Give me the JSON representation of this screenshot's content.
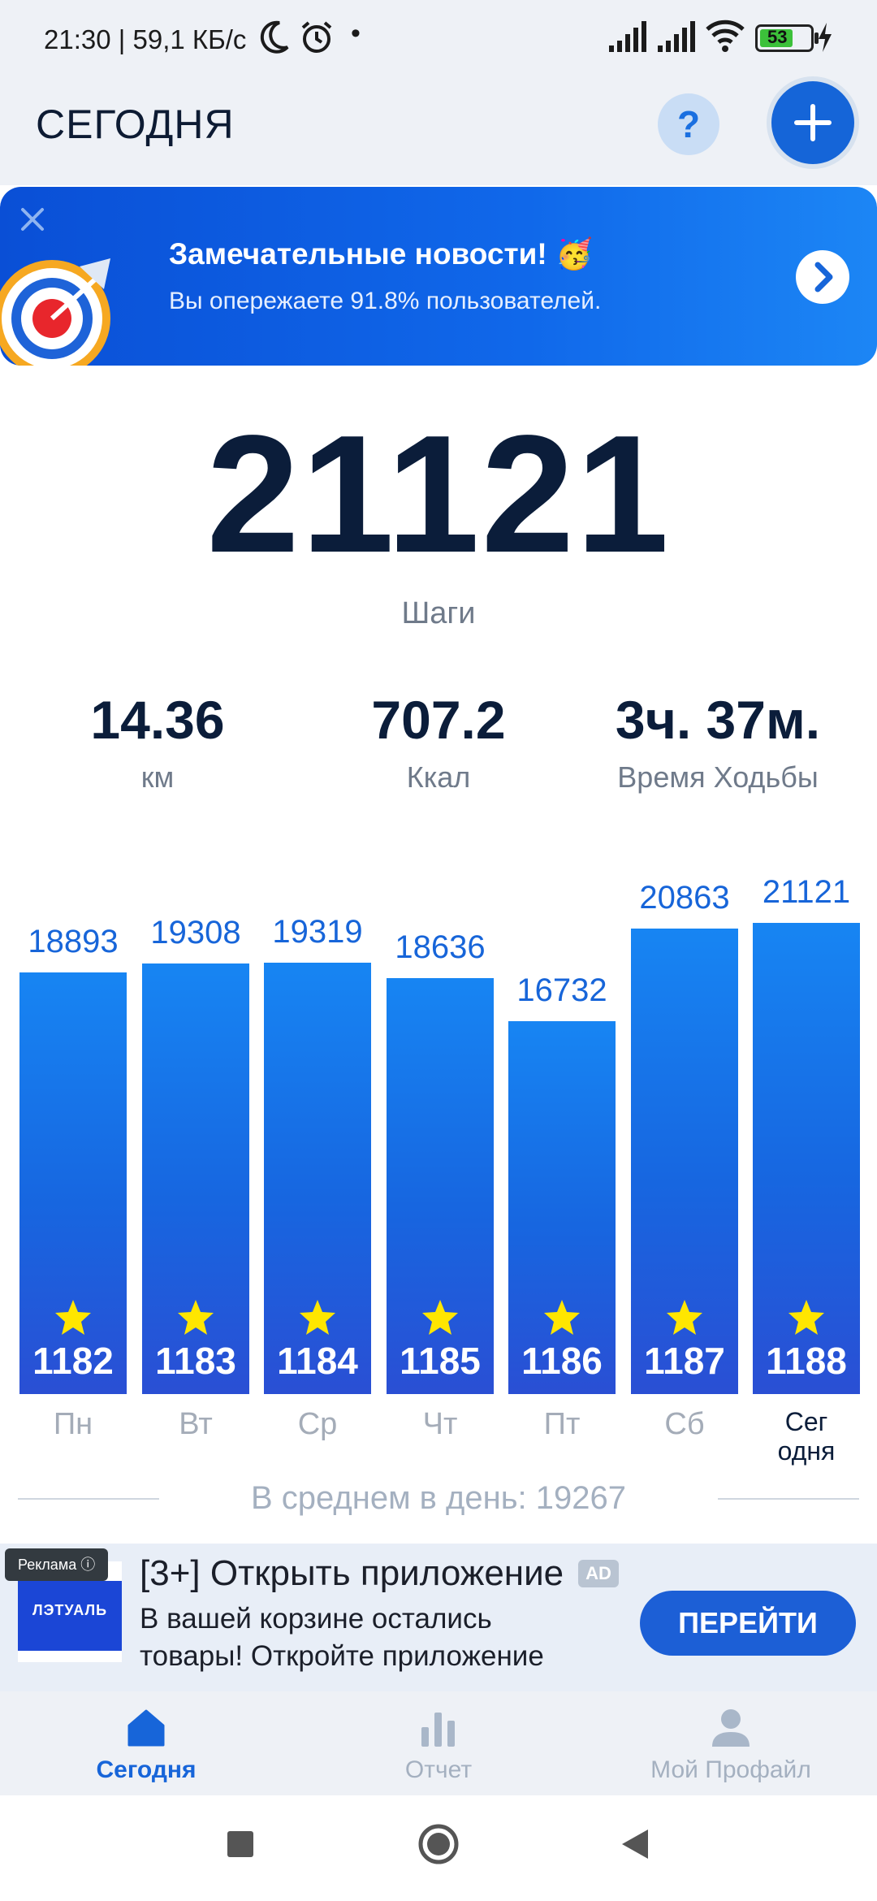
{
  "status_bar": {
    "time_net": "21:30 | 59,1 КБ/с",
    "dot": "•",
    "battery": "53"
  },
  "header": {
    "title": "СЕГОДНЯ",
    "help_label": "?"
  },
  "banner": {
    "title": "Замечательные новости! 🥳",
    "subtitle": "Вы опережаете 91.8% пользователей."
  },
  "steps": {
    "value": "21121",
    "label": "Шаги"
  },
  "stats": {
    "distance": {
      "value": "14.36",
      "unit": "км"
    },
    "calories": {
      "value": "707.2",
      "unit": "Ккал"
    },
    "time": {
      "value": "3ч. 37м.",
      "label": "Время Ходьбы"
    }
  },
  "chart_data": {
    "type": "bar",
    "categories": [
      "Пн",
      "Вт",
      "Ср",
      "Чт",
      "Пт",
      "Сб",
      "Сег одня"
    ],
    "values": [
      18893,
      19308,
      19319,
      18636,
      16732,
      20863,
      21121
    ],
    "bar_labels": [
      "1182",
      "1183",
      "1184",
      "1185",
      "1186",
      "1187",
      "1188"
    ],
    "today_label_lines": [
      "Сег",
      "одня"
    ],
    "ylim": [
      0,
      21121
    ],
    "grid": false,
    "colors": {
      "bar_top": "#1785f3",
      "bar_bottom": "#2a4fd4",
      "value_label": "#1765d9",
      "star": "#ffe600"
    }
  },
  "average": {
    "text": "В среднем в день: 19267"
  },
  "ad": {
    "tag": "Реклама ⓘ",
    "logo_text": "ЛЭТУАЛЬ",
    "title": "[3+] Открыть приложение",
    "badge": "AD",
    "desc_line1": "В вашей корзине остались",
    "desc_line2": "товары! Откройте приложение",
    "cta": "ПЕРЕЙТИ"
  },
  "bottom_nav": {
    "items": [
      {
        "label": "Сегодня",
        "icon": "home-icon",
        "active": true
      },
      {
        "label": "Отчет",
        "icon": "bar-chart-icon",
        "active": false
      },
      {
        "label": "Мой Профайл",
        "icon": "person-icon",
        "active": false
      }
    ]
  }
}
